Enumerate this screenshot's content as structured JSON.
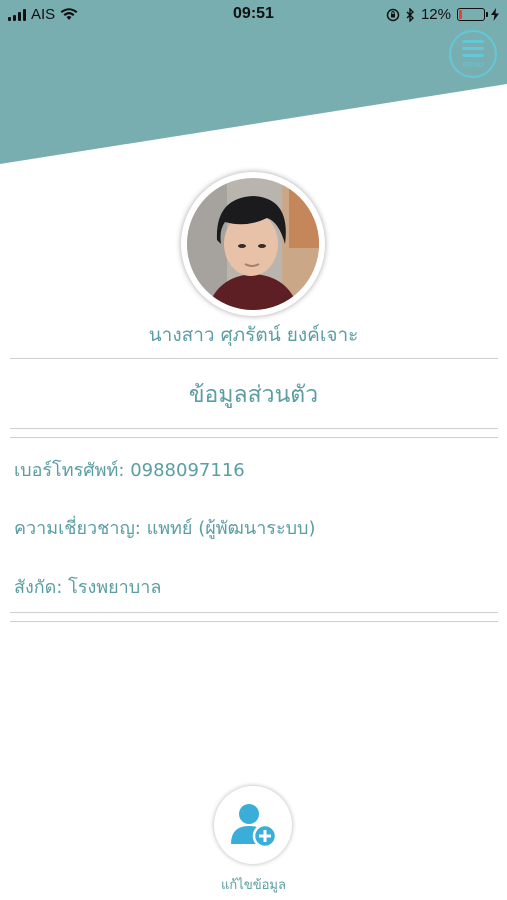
{
  "status_bar": {
    "carrier": "AIS",
    "time": "09:51",
    "battery_percent": "12%",
    "battery_level": 0.12
  },
  "header": {
    "menu_label": "MENU"
  },
  "profile": {
    "name": "นางสาว ศุภรัตน์ ยงค์เจาะ"
  },
  "section": {
    "title": "ข้อมูลส่วนตัว"
  },
  "info": {
    "phone": "เบอร์โทรศัพท์: 0988097116",
    "expertise": "ความเชี่ยวชาญ: แพทย์ (ผู้พัฒนาระบบ)",
    "affiliation": "สังกัด: โรงพยาบาล"
  },
  "actions": {
    "edit_label": "แก้ไขข้อมูล"
  },
  "colors": {
    "header": "#78aeb0",
    "accent": "#5a9ea3",
    "icon": "#3aaed8",
    "battery_low": "#e0453a"
  }
}
